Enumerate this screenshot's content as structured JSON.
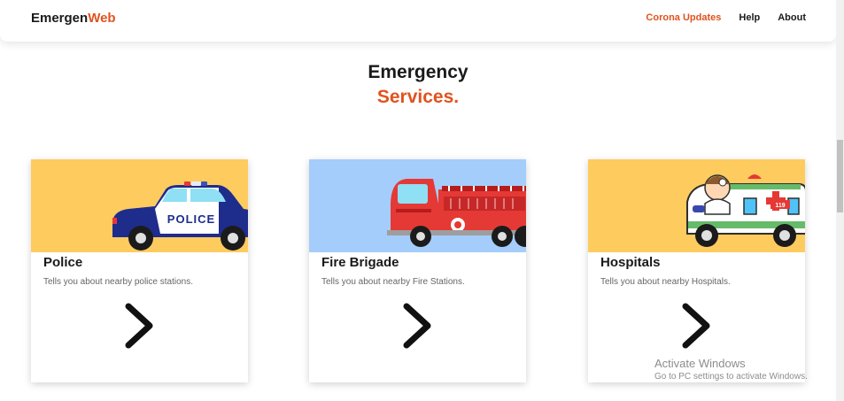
{
  "navbar": {
    "brand_main": "Emergen",
    "brand_accent": "Web",
    "links": [
      {
        "label": "Corona Updates",
        "active": true
      },
      {
        "label": "Help",
        "active": false
      },
      {
        "label": "About",
        "active": false
      }
    ]
  },
  "heading": {
    "line1": "Emergency",
    "line2": "Services."
  },
  "cards": [
    {
      "title": "Police",
      "description": "Tells you about nearby police stations.",
      "image_bg": "#fecb5f",
      "illustration": "police-car",
      "car_text": "POLICE"
    },
    {
      "title": "Fire Brigade",
      "description": "Tells you about nearby Fire Stations.",
      "image_bg": "#a4cdfc",
      "illustration": "fire-truck"
    },
    {
      "title": "Hospitals",
      "description": "Tells you about nearby Hospitals.",
      "image_bg": "#fecb5f",
      "illustration": "ambulance",
      "ambulance_number": "119"
    }
  ],
  "watermark": {
    "title": "Activate Windows",
    "subtitle": "Go to PC settings to activate Windows."
  },
  "colors": {
    "accent": "#e0531f",
    "text": "#1a1a1a"
  }
}
